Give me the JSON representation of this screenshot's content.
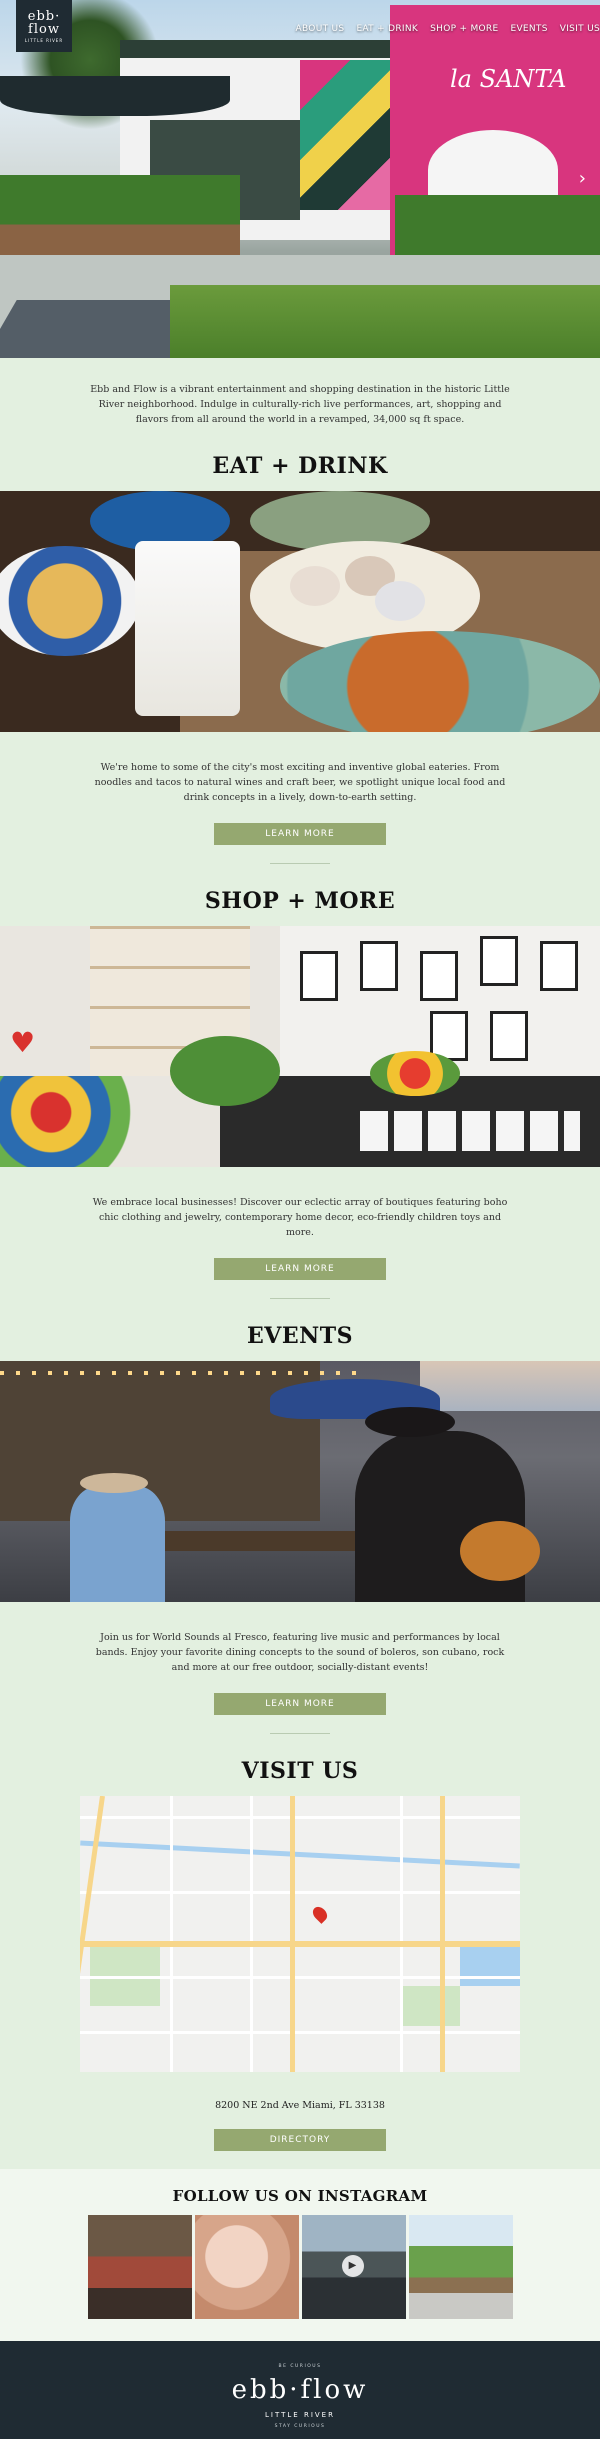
{
  "logo": {
    "line1": "ebb·",
    "line2": "flow",
    "line3": "LITTLE RIVER"
  },
  "nav": {
    "items": [
      "ABOUT US",
      "EAT + DRINK",
      "SHOP + MORE",
      "EVENTS",
      "VISIT US"
    ]
  },
  "hero": {
    "sign": "la SANTA",
    "next_arrow": "›"
  },
  "intro": {
    "text": "Ebb and Flow is a vibrant entertainment and shopping destination in the historic Little River neighborhood. Indulge in culturally-rich live performances, art, shopping and flavors from all around the world in a revamped, 34,000 sq ft space."
  },
  "eat": {
    "title": "EAT + DRINK",
    "text": "We're home to some of the city's most exciting and inventive global eateries. From noodles and tacos to natural wines and craft beer, we spotlight unique local food and drink concepts in a lively, down-to-earth setting.",
    "button": "LEARN MORE"
  },
  "shop": {
    "title": "SHOP + MORE",
    "text": "We embrace local businesses! Discover our eclectic array of boutiques featuring boho chic clothing and jewelry, contemporary home decor, eco-friendly children toys and more.",
    "button": "LEARN MORE"
  },
  "events": {
    "title": "EVENTS",
    "text": "Join us for World Sounds al Fresco, featuring live music and performances by local bands. Enjoy your favorite dining concepts to the sound of boleros, son cubano, rock and more at our free outdoor, socially-distant events!",
    "button": "LEARN MORE"
  },
  "visit": {
    "title": "VISIT US",
    "address": "8200 NE 2nd Ave Miami, FL 33138",
    "button": "DIRECTORY"
  },
  "instagram": {
    "title": "FOLLOW US ON INSTAGRAM",
    "play_icon": "▶"
  },
  "footer": {
    "small": "BE CURIOUS",
    "brand": "ebb·flow",
    "sub": "LITTLE RIVER",
    "sub2": "STAY CURIOUS"
  },
  "colors": {
    "page_bg": "#e3f0e0",
    "button_bg": "#95a870",
    "footer_bg": "#1f2b33",
    "accent_pink": "#d8357e"
  }
}
